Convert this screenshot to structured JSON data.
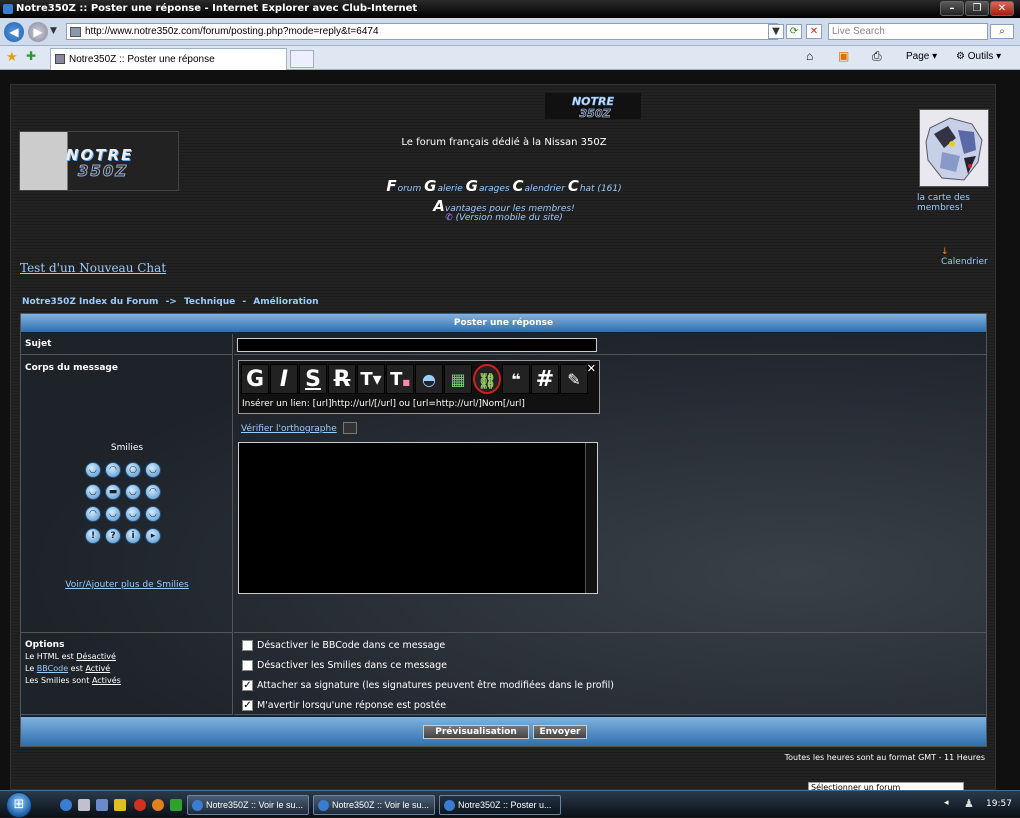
{
  "window": {
    "title": "Notre350Z :: Poster une réponse - Internet Explorer avec Club-Internet",
    "url": "http://www.notre350z.com/forum/posting.php?mode=reply&t=6474",
    "search_placeholder": "Live Search",
    "tab_title": "Notre350Z :: Poster une réponse",
    "toolbar_page": "Page",
    "toolbar_tools": "Outils"
  },
  "site": {
    "tagline": "Le forum français dédié à la Nissan 350Z",
    "nav": {
      "forum": "orum",
      "galerie": "alerie",
      "garages": "arages",
      "calendrier": "alendrier",
      "chat": "hat (161)",
      "avantages": "vantages pour les membres!",
      "mobile": "(Version mobile du site)"
    },
    "map_link": "la carte des membres!",
    "calendar_link": "Calendrier",
    "chat_topic": "Test d'un Nouveau Chat",
    "breadcrumb": [
      "Notre350Z Index du Forum",
      "->",
      "Technique",
      "-",
      "Amélioration"
    ]
  },
  "form": {
    "header": "Poster une réponse",
    "subject_label": "Sujet",
    "body_label": "Corps du message",
    "smilies_title": "Smilies",
    "more_smilies": "Voir/Ajouter plus de Smilies",
    "toolbar_hint": "Insérer un lien: [url]http://url/[/url] ou [url=http://url/]Nom[/url]",
    "spellcheck": "Vérifier l'orthographe",
    "options_label": "Options",
    "html_status": [
      "Le HTML est",
      "Désactivé"
    ],
    "bbcode_status": [
      "Le",
      "BBCode",
      "est",
      "Activé"
    ],
    "smilies_status": [
      "Les Smilies sont",
      "Activés"
    ],
    "options": [
      {
        "label": "Désactiver le BBCode dans ce message",
        "checked": false
      },
      {
        "label": "Désactiver les Smilies dans ce message",
        "checked": false
      },
      {
        "label": "Attacher sa signature (les signatures peuvent être modifiées dans le profil)",
        "checked": true
      },
      {
        "label": "M'avertir lorsqu'une réponse est postée",
        "checked": true
      }
    ],
    "preview_button": "Prévisualisation",
    "submit_button": "Envoyer"
  },
  "footer": {
    "timezone": "Toutes les heures sont au format GMT - 11 Heures",
    "jump_select": "Sélectionner un forum"
  },
  "taskbar": {
    "tasks": [
      "Notre350Z :: Voir le su...",
      "Notre350Z :: Voir le su...",
      "Notre350Z :: Poster u..."
    ],
    "clock": "19:57"
  }
}
